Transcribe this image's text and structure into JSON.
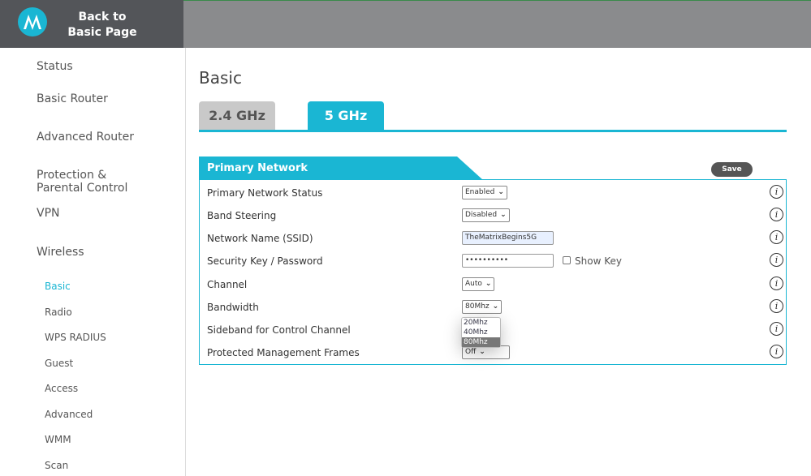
{
  "header": {
    "back_label_1": "Back to",
    "back_label_2": "Basic Page"
  },
  "sidebar": {
    "items": [
      "Status",
      "Basic Router",
      "Advanced Router",
      "Protection &",
      "Parental Control",
      "VPN",
      "Wireless"
    ],
    "sub": [
      "Basic",
      "Radio",
      "WPS RADIUS",
      "Guest",
      "Access",
      "Advanced",
      "WMM",
      "Scan"
    ]
  },
  "page": {
    "title": "Basic",
    "tabs": [
      "2.4 GHz",
      "5 GHz"
    ],
    "section": "Primary Network",
    "save": "Save"
  },
  "rows": [
    {
      "label": "Primary Network Status",
      "value": "Enabled"
    },
    {
      "label": "Band Steering",
      "value": "Disabled"
    },
    {
      "label": "Network Name (SSID)",
      "value": "TheMatrixBegins5G"
    },
    {
      "label": "Security Key / Password",
      "value": "••••••••••",
      "extra": "Show Key"
    },
    {
      "label": "Channel",
      "value": "Auto"
    },
    {
      "label": "Bandwidth",
      "value": "80Mhz"
    },
    {
      "label": "Sideband for Control Channel",
      "value": ""
    },
    {
      "label": "Protected Management Frames",
      "value": "Off"
    }
  ],
  "dropdown": {
    "options": [
      "20Mhz",
      "40Mhz",
      "80Mhz"
    ],
    "selected": "80Mhz"
  },
  "info_glyph": "i"
}
